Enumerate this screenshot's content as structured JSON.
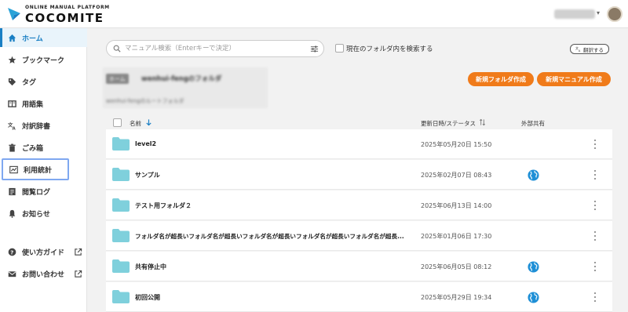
{
  "header": {
    "logo_subtitle": "ONLINE MANUAL PLATFORM",
    "logo_title": "COCOMITE",
    "user_caret": "▾"
  },
  "sidebar": {
    "items": [
      {
        "label": "ホーム",
        "icon": "home-icon",
        "active": true
      },
      {
        "label": "ブックマーク",
        "icon": "star-icon"
      },
      {
        "label": "タグ",
        "icon": "tag-icon"
      },
      {
        "label": "用語集",
        "icon": "glossary-icon"
      },
      {
        "label": "対訳辞書",
        "icon": "translate-icon"
      },
      {
        "label": "ごみ箱",
        "icon": "trash-icon"
      },
      {
        "label": "利用統計",
        "icon": "statistics-icon",
        "highlighted": true
      },
      {
        "label": "閲覧ログ",
        "icon": "log-icon"
      },
      {
        "label": "お知らせ",
        "icon": "bell-icon"
      }
    ],
    "bottom_items": [
      {
        "label": "使い方ガイド",
        "icon": "help-icon"
      },
      {
        "label": "お問い合わせ",
        "icon": "mail-icon"
      }
    ]
  },
  "search": {
    "placeholder": "マニュアル検索（Enterキーで決定）",
    "folder_scope_label": "現在のフォルダ内を検索する",
    "translate_button": "翻訳する"
  },
  "folder_header": {
    "home_badge": "ホーム",
    "title": "wenhui-fengのフォルダ",
    "subtitle": "wenhui-fengのルートフォルダ"
  },
  "actions": {
    "new_folder": "新規フォルダ作成",
    "new_manual": "新規マニュアル作成"
  },
  "table": {
    "columns": {
      "name": "名前",
      "updated": "更新日時/ステータス",
      "external_share": "外部共有"
    },
    "rows": [
      {
        "name": "level2",
        "date": "2025年05月20日 15:50",
        "shared": false
      },
      {
        "name": "サンプル",
        "date": "2025年02月07日 08:43",
        "shared": true
      },
      {
        "name": "テスト用フォルダ２",
        "date": "2025年06月13日 14:00",
        "shared": false
      },
      {
        "name": "フォルダ名が超長いフォルダ名が超長いフォルダ名が超長いフォルダ名が超長いフォルダ名が超長...",
        "date": "2025年01月06日 17:30",
        "shared": false
      },
      {
        "name": "共有停止中",
        "date": "2025年06月05日 08:12",
        "shared": true
      },
      {
        "name": "初回公開",
        "date": "2025年05月29日 19:34",
        "shared": true
      }
    ]
  },
  "colors": {
    "accent_blue": "#1a7fc4",
    "orange": "#f07b1a",
    "folder": "#7fd0dc",
    "globe": "#1e8fd6"
  }
}
